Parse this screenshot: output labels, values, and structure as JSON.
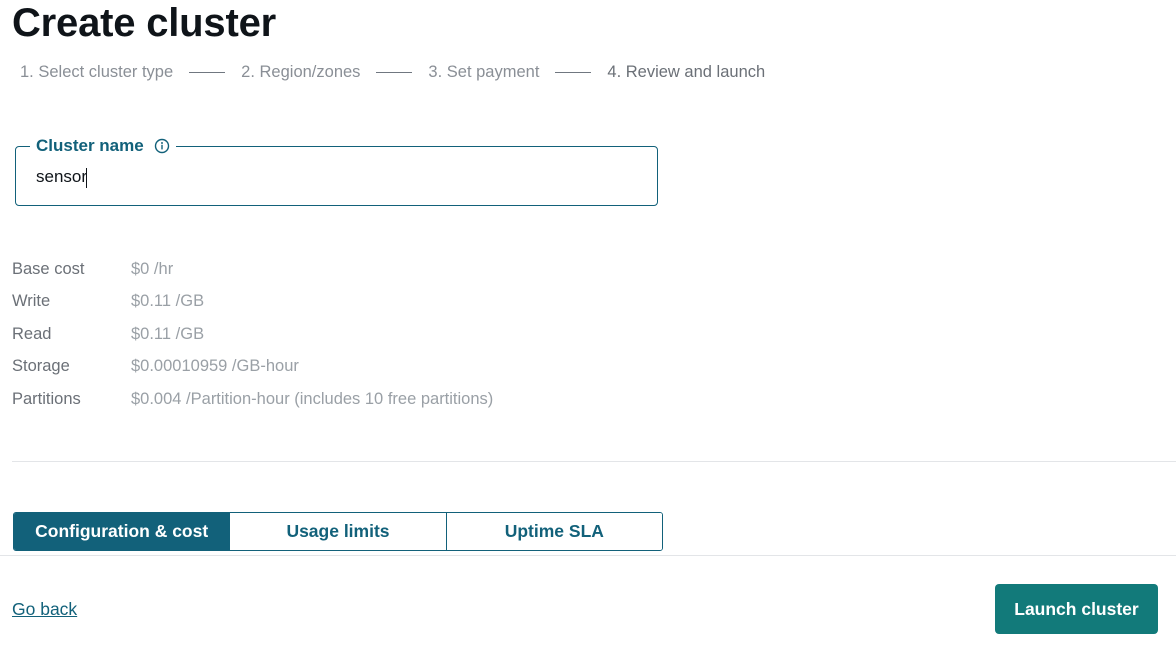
{
  "page": {
    "title": "Create cluster"
  },
  "steps": [
    {
      "label": "1. Select cluster type"
    },
    {
      "label": "2. Region/zones"
    },
    {
      "label": "3. Set payment"
    },
    {
      "label": "4. Review and launch"
    }
  ],
  "cluster_name": {
    "label": "Cluster name",
    "value": "sensor",
    "info_icon": "info-circle-icon"
  },
  "costs": [
    {
      "label": "Base cost",
      "value": "$0 /hr"
    },
    {
      "label": "Write",
      "value": "$0.11 /GB"
    },
    {
      "label": "Read",
      "value": "$0.11 /GB"
    },
    {
      "label": "Storage",
      "value": "$0.00010959 /GB-hour"
    },
    {
      "label": "Partitions",
      "value": "$0.004 /Partition-hour (includes 10 free partitions)"
    }
  ],
  "tabs": [
    {
      "label": "Configuration & cost",
      "active": true
    },
    {
      "label": "Usage limits",
      "active": false
    },
    {
      "label": "Uptime SLA",
      "active": false
    }
  ],
  "footer": {
    "back_label": "Go back",
    "launch_label": "Launch cluster"
  },
  "colors": {
    "accent": "#12617a",
    "launch_button": "#127a7a"
  }
}
